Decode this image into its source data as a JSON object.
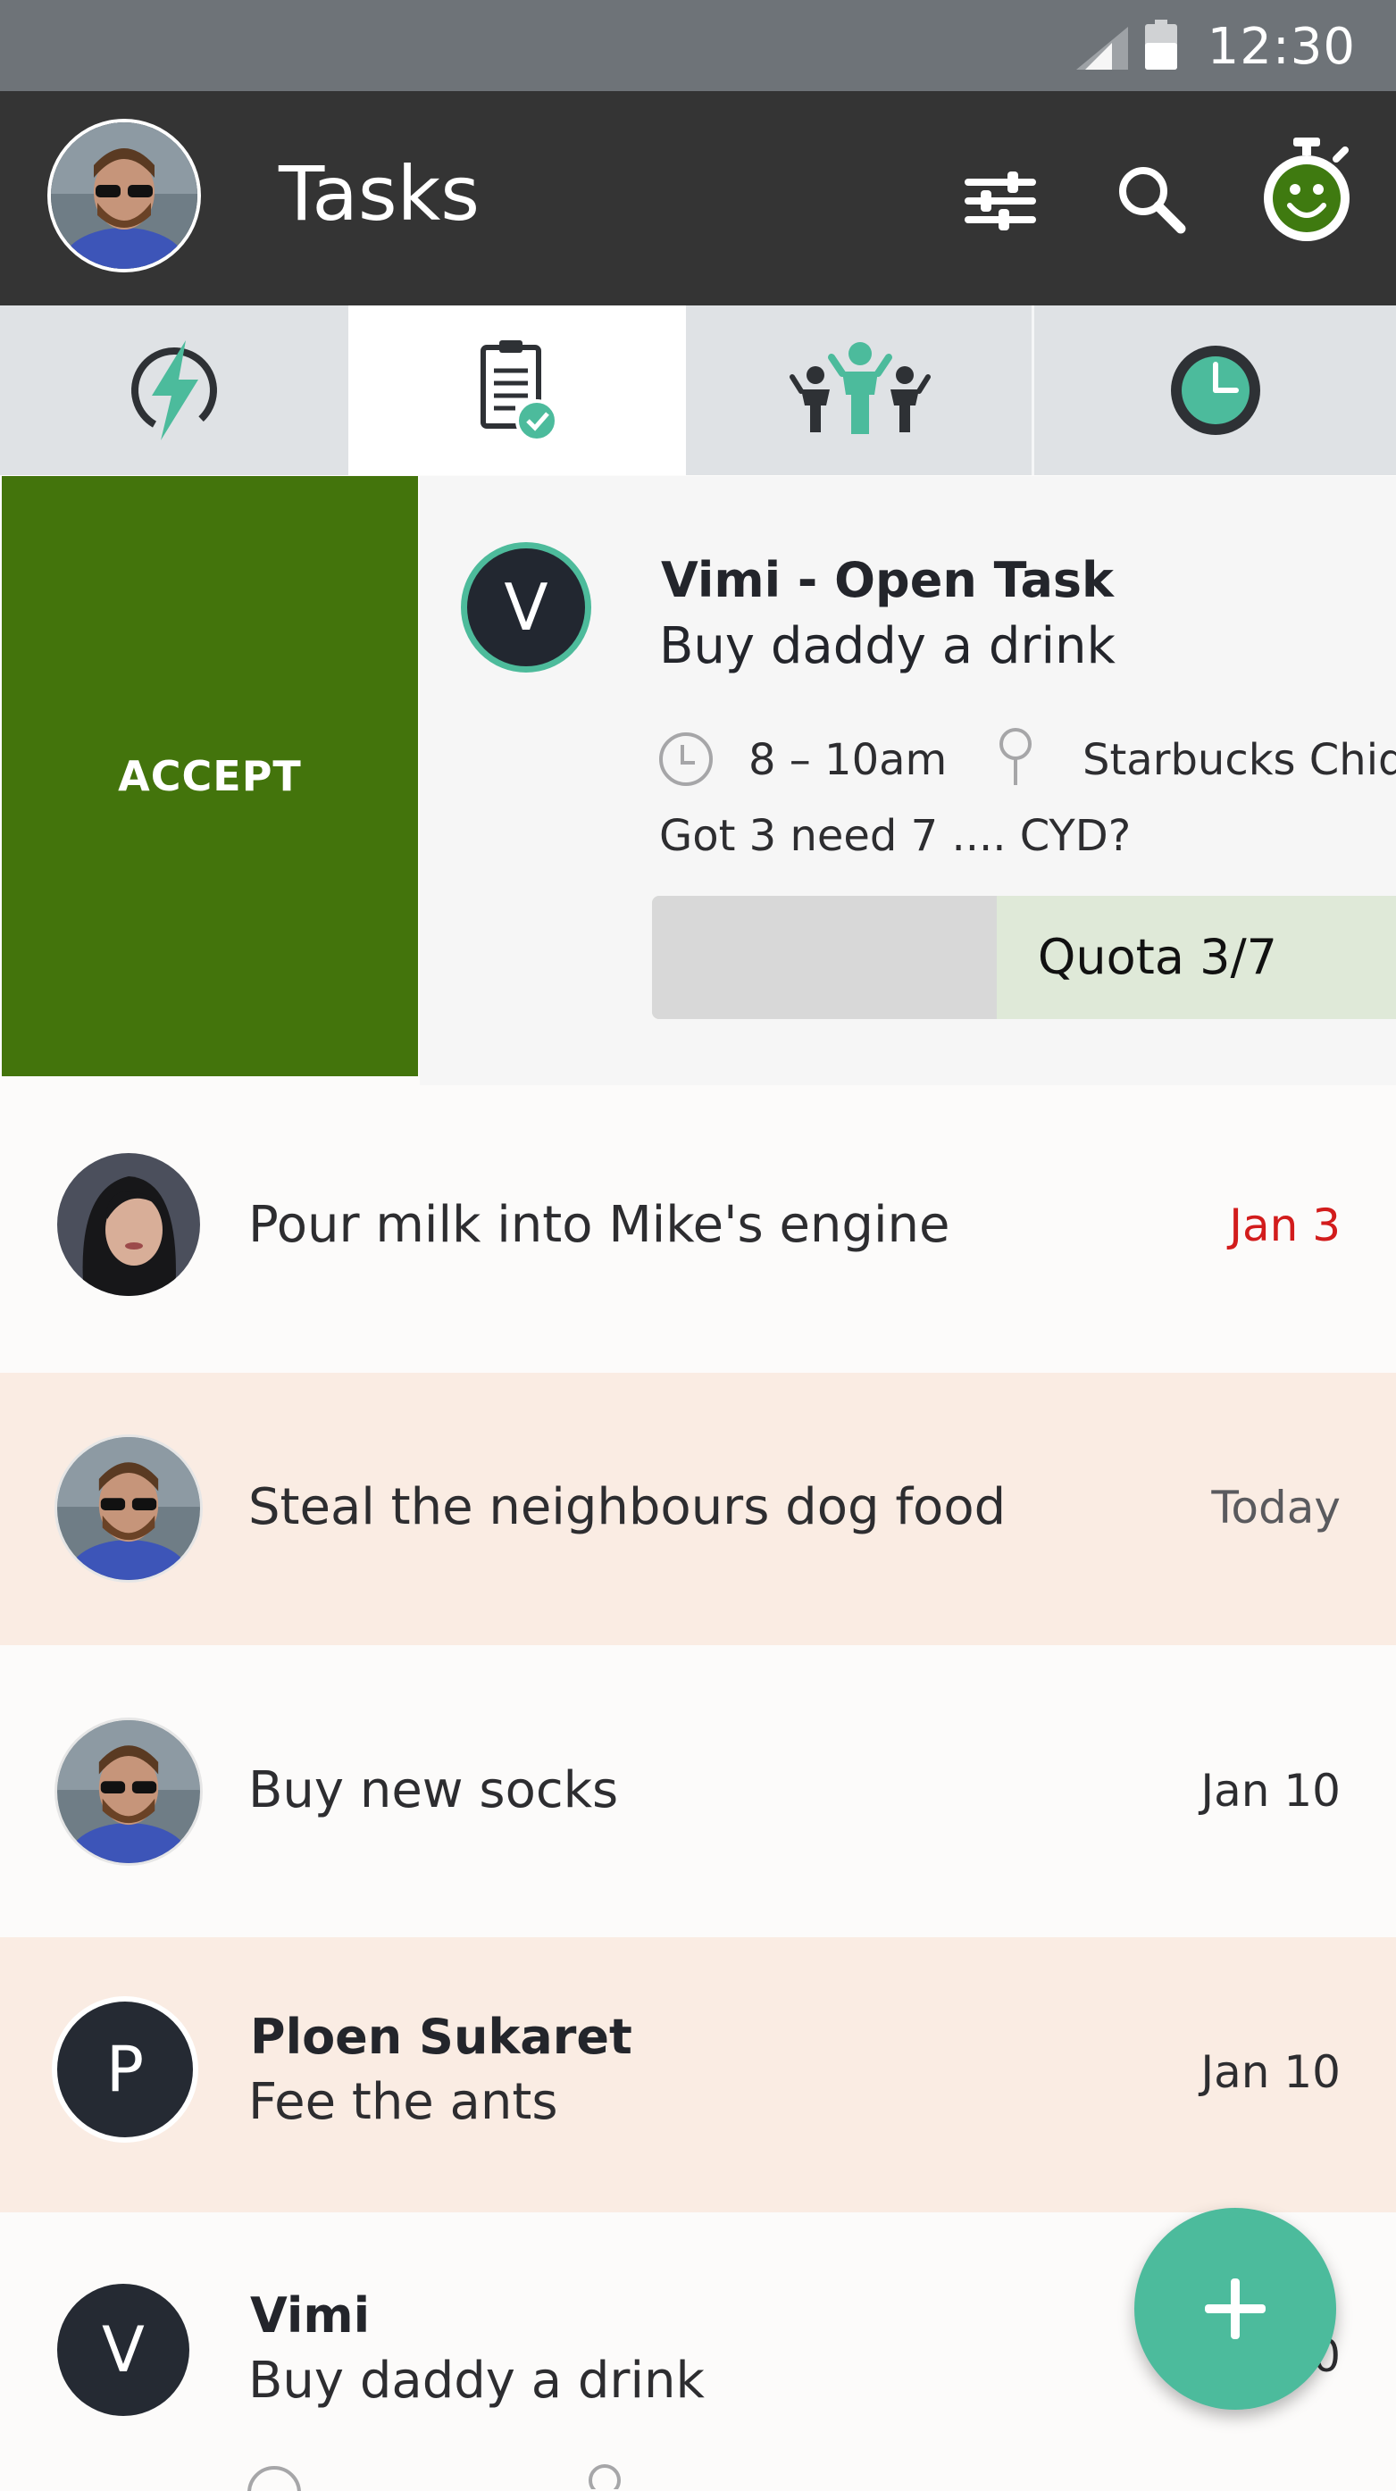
{
  "status_bar": {
    "time": "12:30"
  },
  "app_bar": {
    "title": "Tasks"
  },
  "tabs": [
    {
      "icon": "lightning-icon",
      "active": false
    },
    {
      "icon": "clipboard-check-icon",
      "active": true
    },
    {
      "icon": "group-icon",
      "active": false
    },
    {
      "icon": "clock-icon",
      "active": false
    }
  ],
  "open_task": {
    "action_label": "ACCEPT",
    "avatar_letter": "V",
    "title": "Vimi - Open Task",
    "subtitle": "Buy daddy a drink",
    "time": "8 – 10am",
    "location": "Starbucks Chidl",
    "note": "Got 3 need 7 .... CYD?",
    "quota_label": "Quota 3/7",
    "quota_fraction": 0.4286
  },
  "tasks": [
    {
      "text": "Pour milk into Mike's engine",
      "date": "Jan 3",
      "date_color": "#d21c1c"
    },
    {
      "text": "Steal the neighbours dog food",
      "date": "Today",
      "date_color": "#5a5a5e"
    },
    {
      "text": "Buy new socks",
      "date": "Jan 10",
      "date_color": "#2d2d30"
    },
    {
      "avatar_letter": "P",
      "name": "Ploen Sukaret",
      "text": "Fee the ants",
      "date": "Jan 10",
      "date_color": "#2d2d30"
    },
    {
      "avatar_letter": "V",
      "name": "Vimi",
      "text": "Buy daddy a drink",
      "date": "0",
      "date_color": "#2d2d30"
    }
  ],
  "colors": {
    "accept": "#43740c",
    "accent": "#4cbb9c",
    "highlight_row": "#faece3",
    "app_bar": "#343434"
  }
}
